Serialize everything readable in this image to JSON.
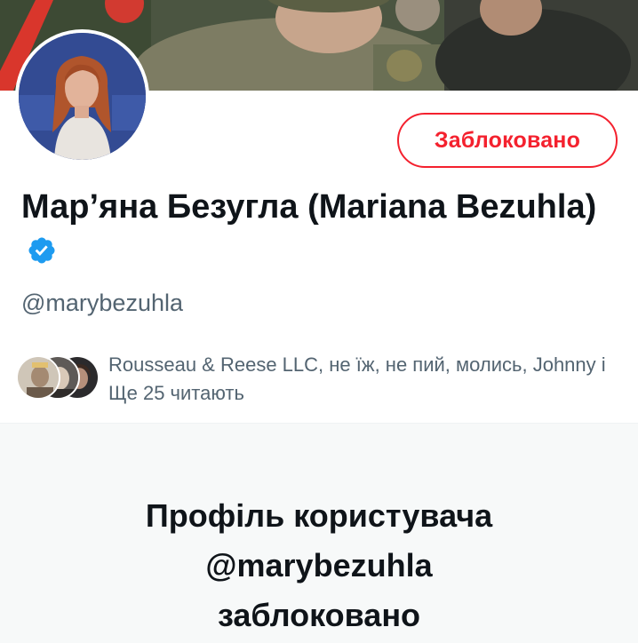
{
  "profile": {
    "display_name": "Мар’яна Безугла (Mariana Bezuhla)",
    "handle": "@marybezuhla",
    "verified_icon": "verified-badge-icon",
    "blocked_button_label": "Заблоковано"
  },
  "followers": {
    "text": "Rousseau & Reese LLC, не їж, не пий, молись, Johnny і Ще 25 читають"
  },
  "blocked_notice": {
    "line1": "Профіль користувача",
    "line2": "@marybezuhla",
    "line3": "заблоковано"
  },
  "colors": {
    "accent_red": "#f4212e",
    "verified_blue": "#1d9bf0",
    "secondary_text": "#536471"
  }
}
